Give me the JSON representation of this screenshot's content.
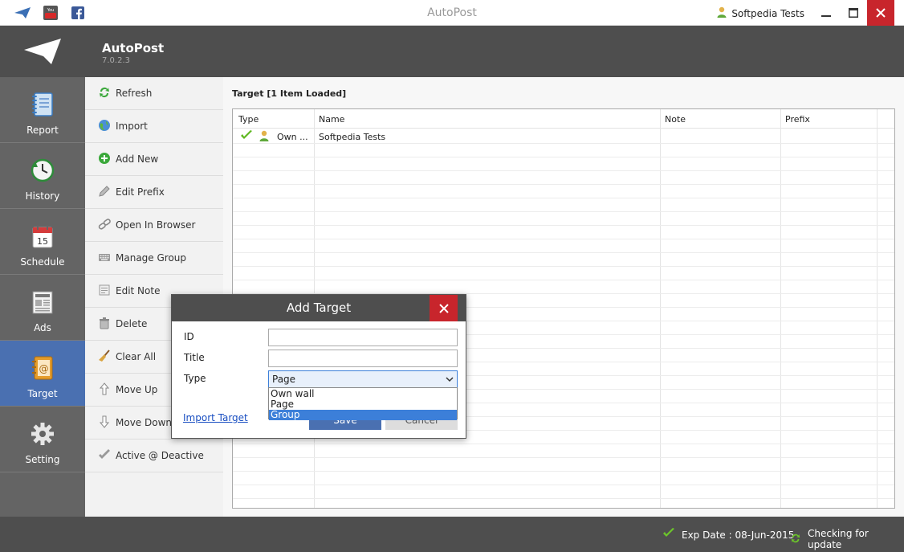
{
  "window": {
    "title": "AutoPost",
    "user": "Softpedia Tests",
    "social": [
      "paper-plane-icon",
      "youtube-icon",
      "facebook-icon"
    ]
  },
  "header": {
    "app_name": "AutoPost",
    "version": "7.0.2.3"
  },
  "nav": {
    "items": [
      {
        "label": "Report",
        "icon": "notebook-icon"
      },
      {
        "label": "History",
        "icon": "clock-icon"
      },
      {
        "label": "Schedule",
        "icon": "calendar-icon"
      },
      {
        "label": "Ads",
        "icon": "newspaper-icon"
      },
      {
        "label": "Target",
        "icon": "address-book-icon",
        "active": true
      },
      {
        "label": "Setting",
        "icon": "gear-icon"
      }
    ]
  },
  "actions": {
    "items": [
      {
        "label": "Refresh",
        "icon": "refresh-icon"
      },
      {
        "label": "Import",
        "icon": "globe-icon"
      },
      {
        "label": "Add New",
        "icon": "add-icon"
      },
      {
        "label": "Edit Prefix",
        "icon": "pencil-icon"
      },
      {
        "label": "Open In Browser",
        "icon": "link-icon"
      },
      {
        "label": "Manage Group",
        "icon": "keyboard-icon"
      },
      {
        "label": "Edit Note",
        "icon": "note-icon"
      },
      {
        "label": "Delete",
        "icon": "delete-icon"
      },
      {
        "label": "Clear All",
        "icon": "broom-icon"
      },
      {
        "label": "Move Up",
        "icon": "arrow-up-icon"
      },
      {
        "label": "Move Down",
        "icon": "arrow-down-icon"
      },
      {
        "label": "Active @ Deactive",
        "icon": "check-icon"
      }
    ]
  },
  "main": {
    "caption": "Target [1 Item Loaded]",
    "columns": [
      "Type",
      "Name",
      "Note",
      "Prefix"
    ],
    "rows": [
      {
        "type": "Own ...",
        "name": "Softpedia Tests",
        "note": "",
        "prefix": ""
      }
    ]
  },
  "status": {
    "exp_date": "Exp Date : 08-Jun-2015",
    "update": "Checking for update"
  },
  "dialog": {
    "title": "Add Target",
    "id_label": "ID",
    "title_label": "Title",
    "type_label": "Type",
    "id_value": "",
    "title_value": "",
    "type_value": "Page",
    "type_options": [
      "Own wall",
      "Page",
      "Group"
    ],
    "type_highlighted": "Group",
    "import_link": "Import Target",
    "save_label": "Save",
    "cancel_label": "Cancel"
  },
  "colors": {
    "header_bg": "#4e4e4e",
    "nav_bg": "#646464",
    "nav_active": "#4a70b1",
    "close_red": "#c8252c",
    "check_green": "#5fb820"
  }
}
